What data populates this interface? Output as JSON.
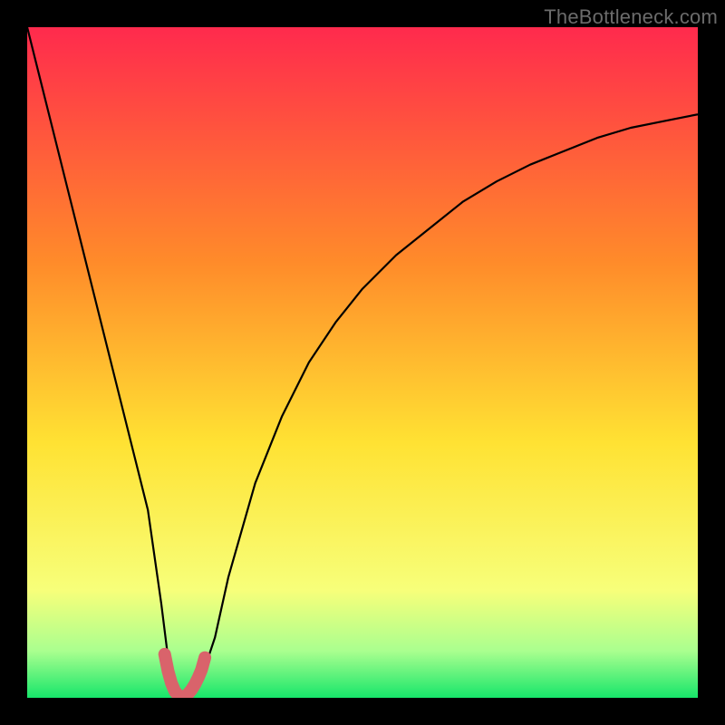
{
  "watermark": "TheBottleneck.com",
  "colors": {
    "background_frame": "#000000",
    "gradient_top": "#ff2a4d",
    "gradient_mid1": "#ff8b2a",
    "gradient_mid2": "#ffe233",
    "gradient_mid3": "#f7ff7a",
    "gradient_band_light": "#aaff8f",
    "gradient_bottom": "#17e66a",
    "curve": "#000000",
    "marker": "#d9636b"
  },
  "chart_data": {
    "type": "line",
    "title": "",
    "xlabel": "",
    "ylabel": "",
    "xlim": [
      0,
      100
    ],
    "ylim": [
      0,
      100
    ],
    "series": [
      {
        "name": "bottleneck-curve",
        "x": [
          0,
          2,
          4,
          6,
          8,
          10,
          12,
          14,
          16,
          18,
          20,
          21,
          22,
          23,
          24,
          25,
          26,
          28,
          30,
          34,
          38,
          42,
          46,
          50,
          55,
          60,
          65,
          70,
          75,
          80,
          85,
          90,
          95,
          100
        ],
        "y": [
          100,
          92,
          84,
          76,
          68,
          60,
          52,
          44,
          36,
          28,
          14,
          6,
          2,
          0,
          0,
          1,
          3,
          9,
          18,
          32,
          42,
          50,
          56,
          61,
          66,
          70,
          74,
          77,
          79.5,
          81.5,
          83.5,
          85,
          86,
          87
        ]
      },
      {
        "name": "optimum-marker",
        "x": [
          20.5,
          21,
          21.5,
          22,
          22.5,
          23,
          23.5,
          24,
          24.5,
          25,
          25.5,
          26,
          26.5
        ],
        "y": [
          6.5,
          4,
          2.2,
          1,
          0.4,
          0,
          0.2,
          0.6,
          1.2,
          2,
          3,
          4.2,
          6
        ]
      }
    ],
    "annotations": [
      {
        "text": "TheBottleneck.com",
        "position": "top-right"
      }
    ],
    "notes": "No numeric axis ticks or labels visible; y-values estimated from plot height (0 at bottom band, 100 at top edge)."
  }
}
